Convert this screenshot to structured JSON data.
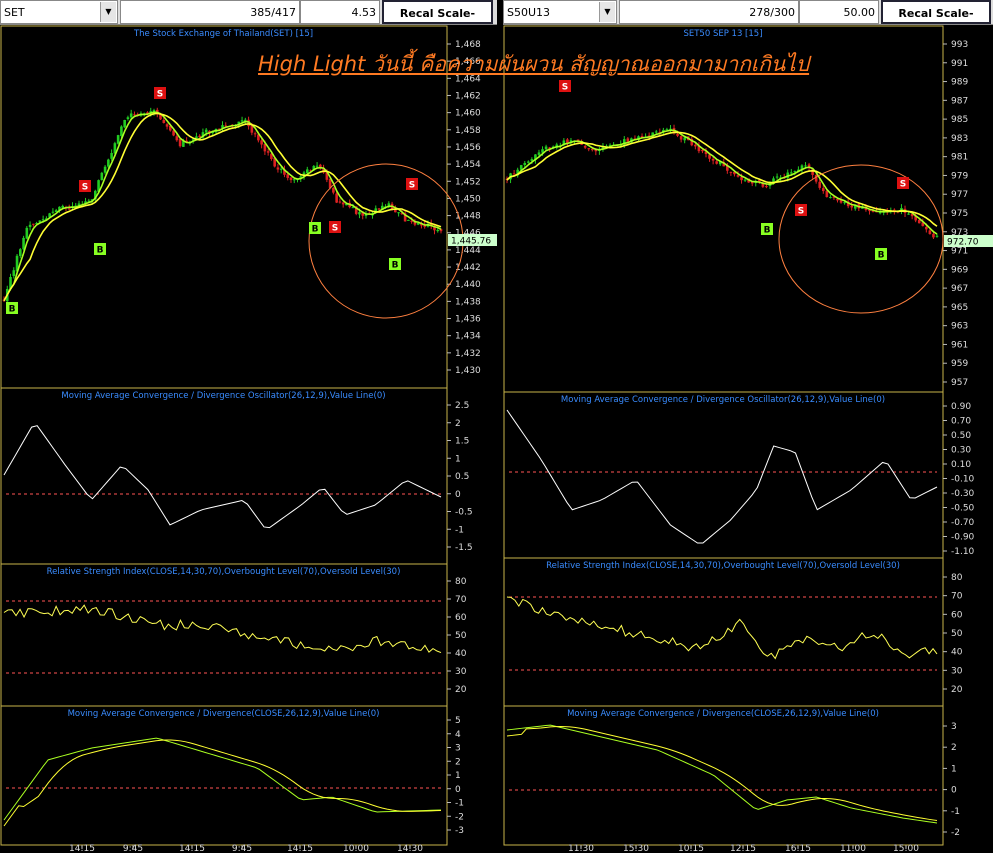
{
  "highlight_text": "High Light วันนี้ คือความผันผวน สัญญาณออกมามากเกินไป",
  "colors": {
    "bg": "#000000",
    "up": "#22cc22",
    "down": "#dd2222",
    "ma1": "#aaff22",
    "ma2": "#ffff33",
    "pane_border": "#c8b44a",
    "dash": "#ff5555",
    "osc": "#ffffff",
    "rsi": "#ffff55",
    "signal_s": "#dd1111",
    "signal_b": "#88ff22",
    "circle": "#ff8040",
    "title": "#3a8cff",
    "highlight": "#ff7a22"
  },
  "left": {
    "symbol": "SET",
    "counter": "385/417",
    "value": "4.53",
    "scale_button": "Recal Scale-Linear",
    "price_title": "The Stock Exchange of Thailand(SET) [15]",
    "price_axis": [
      "1,468",
      "1,466",
      "1,464",
      "1,462",
      "1,460",
      "1,458",
      "1,456",
      "1,454",
      "1,452",
      "1,450",
      "1,448",
      "1,446",
      "1,444",
      "1,442",
      "1,440",
      "1,438",
      "1,436",
      "1,434",
      "1,432",
      "1,430"
    ],
    "last_price": "1,445.76",
    "osc_title": "Moving Average Convergence / Divergence Oscillator(26,12,9),Value Line(0)",
    "osc_axis": [
      "2.5",
      "2",
      "1.5",
      "1",
      "0.5",
      "0",
      "-0.5",
      "-1",
      "-1.5"
    ],
    "rsi_title": "Relative Strength Index(CLOSE,14,30,70),Overbought Level(70),Oversold Level(30)",
    "rsi_axis": [
      "80",
      "70",
      "60",
      "50",
      "40",
      "30",
      "20"
    ],
    "macd_title": "Moving Average Convergence / Divergence(CLOSE,26,12,9),Value Line(0)",
    "macd_axis": [
      "5",
      "4",
      "3",
      "2",
      "1",
      "0",
      "-1",
      "-2",
      "-3"
    ],
    "time_labels": [
      "14:15",
      "9:45",
      "14:15",
      "9:45",
      "14:15",
      "10:00",
      "14:30"
    ],
    "signals": [
      {
        "t": "B"
      },
      {
        "t": "S"
      },
      {
        "t": "B"
      },
      {
        "t": "S"
      },
      {
        "t": "B"
      },
      {
        "t": "S"
      },
      {
        "t": "B"
      },
      {
        "t": "S"
      }
    ]
  },
  "right": {
    "symbol": "S50U13",
    "counter": "278/300",
    "value": "50.00",
    "scale_button": "Recal Scale-Linear",
    "price_title": "SET50 SEP 13   [15]",
    "price_axis": [
      "993",
      "991",
      "989",
      "987",
      "985",
      "983",
      "981",
      "979",
      "977",
      "975",
      "973",
      "971",
      "969",
      "967",
      "965",
      "963",
      "961",
      "959",
      "957"
    ],
    "last_price": "972.70",
    "osc_title": "Moving Average Convergence / Divergence Oscillator(26,12,9),Value Line(0)",
    "osc_axis": [
      "0.90",
      "0.70",
      "0.50",
      "0.30",
      "0.10",
      "-0.10",
      "-0.30",
      "-0.50",
      "-0.70",
      "-0.90",
      "-1.10"
    ],
    "rsi_title": "Relative Strength Index(CLOSE,14,30,70),Overbought Level(70),Oversold Level(30)",
    "rsi_axis": [
      "80",
      "70",
      "60",
      "50",
      "40",
      "30",
      "20"
    ],
    "macd_title": "Moving Average Convergence / Divergence(CLOSE,26,12,9),Value Line(0)",
    "macd_axis": [
      "3",
      "2",
      "1",
      "0",
      "-1",
      "-2"
    ],
    "time_labels": [
      "11:30",
      "15:30",
      "10:15",
      "12:15",
      "16:15",
      "11:00",
      "15:00"
    ],
    "signals": [
      {
        "t": "S"
      },
      {
        "t": "B"
      },
      {
        "t": "S"
      },
      {
        "t": "B"
      },
      {
        "t": "S"
      }
    ]
  }
}
